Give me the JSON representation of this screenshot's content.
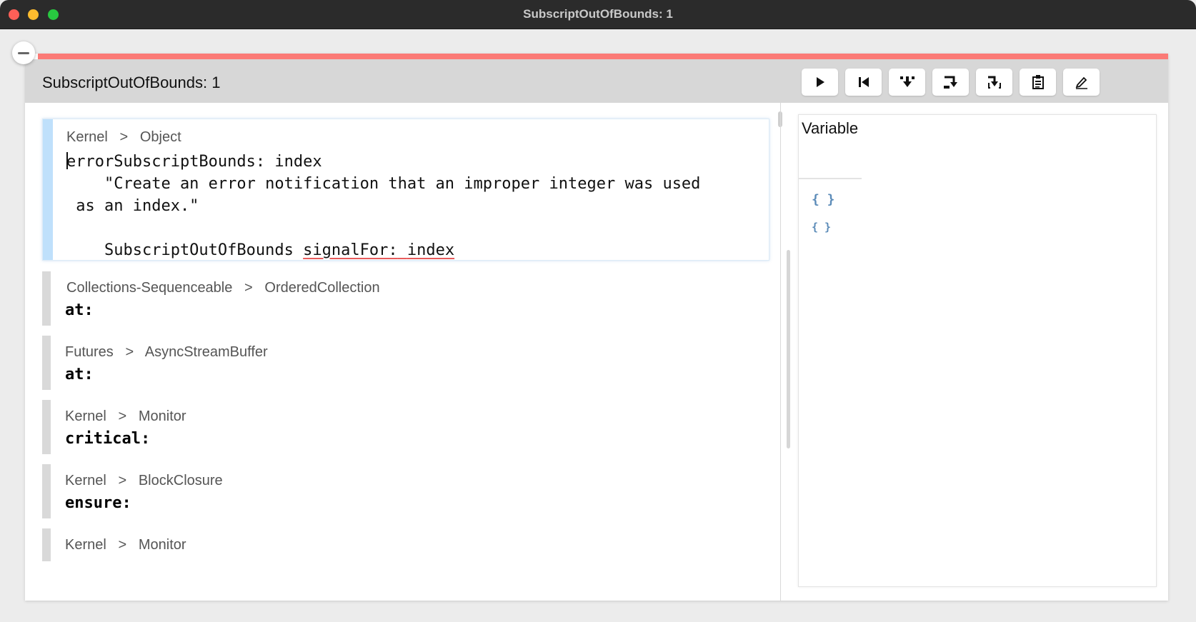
{
  "window": {
    "title": "SubscriptOutOfBounds: 1"
  },
  "panel": {
    "title": "SubscriptOutOfBounds: 1"
  },
  "toolbar": {
    "buttons": [
      "play-icon",
      "restart-icon",
      "step-into-icon",
      "step-over-icon",
      "step-through-icon",
      "clipboard-icon",
      "edit-icon"
    ]
  },
  "stack": {
    "selected": {
      "package": "Kernel",
      "separator": ">",
      "class": "Object",
      "code_line1_rest": "rrorSubscriptBounds: index",
      "code_line1_first": "e",
      "code_line2": "    \"Create an error notification that an improper integer was used",
      "code_line3": " as an index.\"",
      "code_line5_prefix": "    SubscriptOutOfBounds ",
      "code_line5_kw": "signalFor:",
      "code_line5_gap": " ",
      "code_line5_arg": "index"
    },
    "frames": [
      {
        "package": "Collections-Sequenceable",
        "class": "OrderedCollection",
        "selector": "at:"
      },
      {
        "package": "Futures",
        "class": "AsyncStreamBuffer",
        "selector": "at:"
      },
      {
        "package": "Kernel",
        "class": "Monitor",
        "selector": "critical:"
      },
      {
        "package": "Kernel",
        "class": "BlockClosure",
        "selector": "ensure:"
      },
      {
        "package": "Kernel",
        "class": "Monitor",
        "selector": ""
      }
    ]
  },
  "variables": {
    "header": "Variable",
    "items": [
      "{ }",
      "{ }"
    ]
  }
}
